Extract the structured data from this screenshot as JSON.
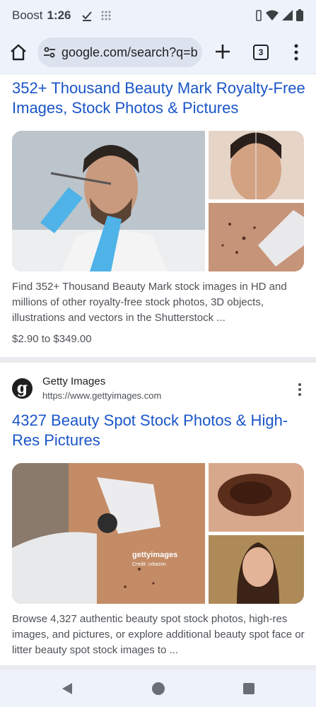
{
  "status_bar": {
    "carrier": "Boost",
    "time": "1:26"
  },
  "toolbar": {
    "url": "google.com/search?q=b",
    "tab_count": "3",
    "icons": [
      "home-icon",
      "tune-icon",
      "plus-icon",
      "tabs-icon",
      "menu-icon"
    ]
  },
  "result1": {
    "title": "352+ Thousand Beauty Mark Royalty-Free Images, Stock Photos & Pictures",
    "description": "Find 352+ Thousand Beauty Mark stock images in HD and millions of other royalty-free stock photos, 3D objects, illustrations and vectors in the Shutterstock ...",
    "price": "$2.90 to $349.00"
  },
  "result2": {
    "site_name": "Getty Images",
    "site_url": "https://www.gettyimages.com",
    "favicon_letter": "g",
    "title": "4327 Beauty Spot Stock Photos & High-Res Pictures",
    "description": "Browse 4,327 authentic beauty spot stock photos, high-res images, and pictures, or explore additional beauty spot face or litter beauty spot stock images to ...",
    "watermark": "gettyimages",
    "credit": "Credit: urbazon"
  },
  "colors": {
    "link": "#1a55c8",
    "chrome_bg": "#eef2fa",
    "divider": "#e9ebee"
  }
}
